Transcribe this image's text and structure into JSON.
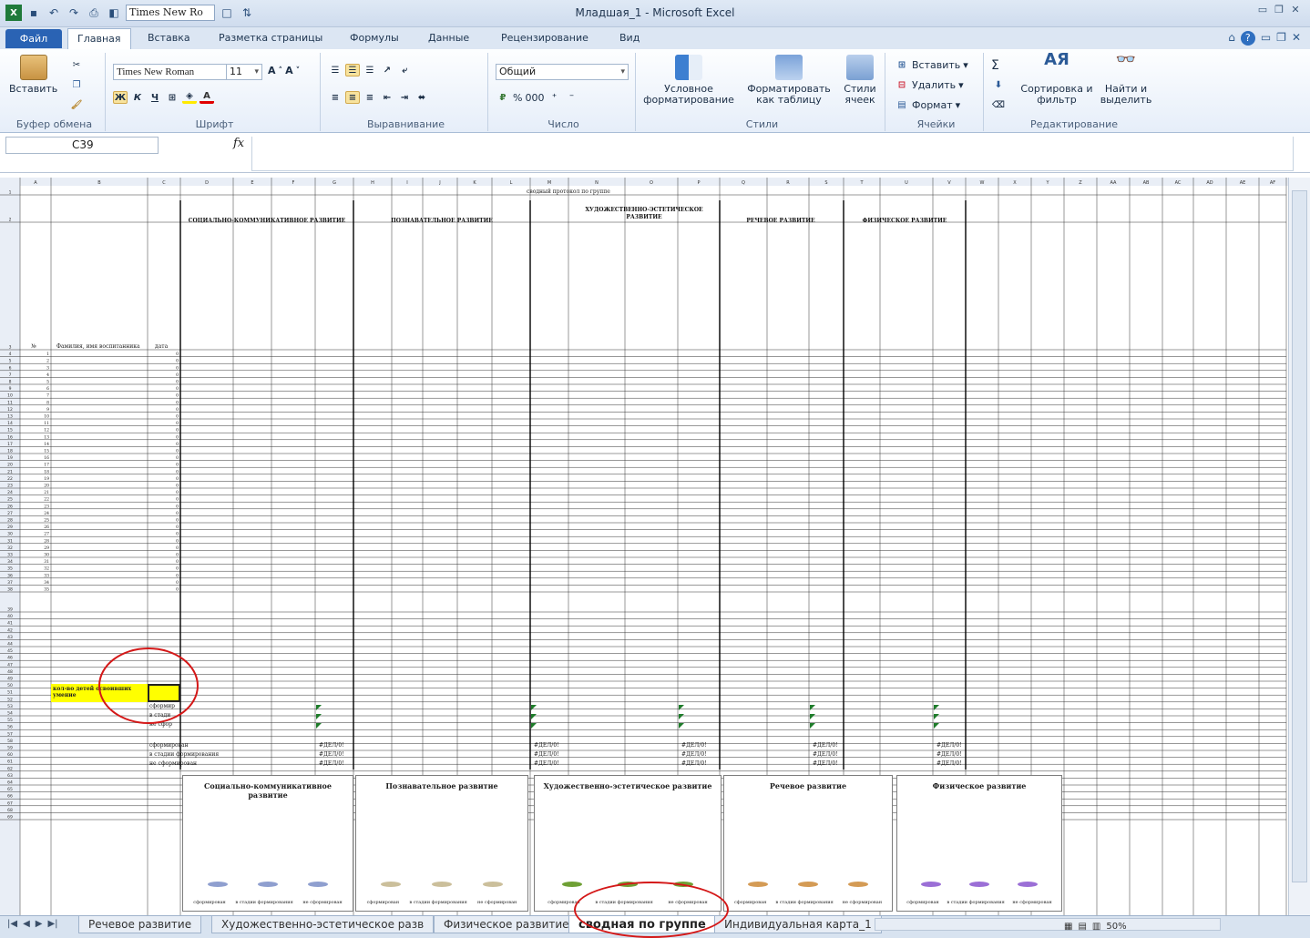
{
  "window": {
    "title": "Младшая_1  -  Microsoft Excel",
    "qat_font": "Times New Ro"
  },
  "ribbon_tabs": [
    "Файл",
    "Главная",
    "Вставка",
    "Разметка страницы",
    "Формулы",
    "Данные",
    "Рецензирование",
    "Вид"
  ],
  "ribbon": {
    "clipboard": {
      "paste": "Вставить",
      "label": "Буфер обмена"
    },
    "font": {
      "name": "Times New Roman",
      "size": "11",
      "bold": "Ж",
      "italic": "К",
      "underline": "Ч",
      "label": "Шрифт"
    },
    "align": {
      "label": "Выравнивание"
    },
    "number": {
      "format": "Общий",
      "percent": "%",
      "thousands": "000",
      "label": "Число"
    },
    "styles": {
      "conditional": "Условное форматирование",
      "as_table": "Форматировать как таблицу",
      "cell_styles": "Стили ячеек",
      "label": "Стили"
    },
    "cells": {
      "insert": "Вставить",
      "delete": "Удалить",
      "format": "Формат",
      "label": "Ячейки"
    },
    "editing": {
      "sigma": "Σ",
      "sort": "Сортировка и фильтр",
      "find": "Найти и выделить",
      "label": "Редактирование"
    }
  },
  "formula_bar": {
    "name_box": "C39",
    "fx": "fx",
    "value": ""
  },
  "sheet": {
    "col_headers": [
      "A",
      "B",
      "C",
      "D",
      "E",
      "F",
      "G",
      "H",
      "I",
      "J",
      "K",
      "L",
      "M",
      "N",
      "O",
      "P",
      "Q",
      "R",
      "S",
      "T",
      "U",
      "V",
      "W",
      "X",
      "Y",
      "Z",
      "AA",
      "AB",
      "AC",
      "AD",
      "AE",
      "AF"
    ],
    "title_cell": "сводный протокол по группе",
    "sections": {
      "social": "СОЦИАЛЬНО-КОММУНИКАТИВНОЕ РАЗВИТИЕ",
      "cognitive": "ПОЗНАВАТЕЛЬНОЕ РАЗВИТИЕ",
      "artistic": "ХУДОЖЕСТВЕННО-ЭСТЕТИЧЕСКОЕ РАЗВИТИЕ",
      "speech": "РЕЧЕВОЕ РАЗВИТИЕ",
      "physical": "ФИЗИЧЕСКОЕ РАЗВИТИЕ"
    },
    "headers": {
      "num": "№",
      "name": "Фамилия, имя воспитанника",
      "date": "дата"
    },
    "summary_label": "кол-во детей освоивших умение",
    "level_rows": [
      "сформир",
      "в стади",
      "не сфор"
    ],
    "pct_rows": [
      "сформирован",
      "в стадии формирования",
      "не сформирован"
    ],
    "div_error": "#ДЕЛ/0!"
  },
  "charts": [
    {
      "title": "Социально-коммуникативное развитие",
      "color": "#8f9fcf",
      "labels": [
        "сформирован",
        "в стадии формирования",
        "не сформирован"
      ]
    },
    {
      "title": "Познавательное развитие",
      "color": "#cbbf9b",
      "labels": [
        "сформирован",
        "в стадии формирования",
        "не сформирован"
      ]
    },
    {
      "title": "Художественно-эстетическое развитие",
      "color": "#6fa035",
      "labels": [
        "сформирован",
        "в стадии формирования",
        "не сформирован"
      ]
    },
    {
      "title": "Речевое развитие",
      "color": "#d49b55",
      "labels": [
        "сформирован",
        "в стадии формирования",
        "не сформирован"
      ]
    },
    {
      "title": "Физическое развитие",
      "color": "#9b6fd6",
      "labels": [
        "сформирован",
        "в стадии формирования",
        "не сформирован"
      ]
    }
  ],
  "sheet_tabs": [
    "Речевое развитие",
    "Художественно-эстетическое разв",
    "Физическое развитие",
    "сводная по группе",
    "Индивидуальная карта_1"
  ],
  "active_tab": "сводная по группе",
  "status": {
    "zoom": "50%"
  }
}
